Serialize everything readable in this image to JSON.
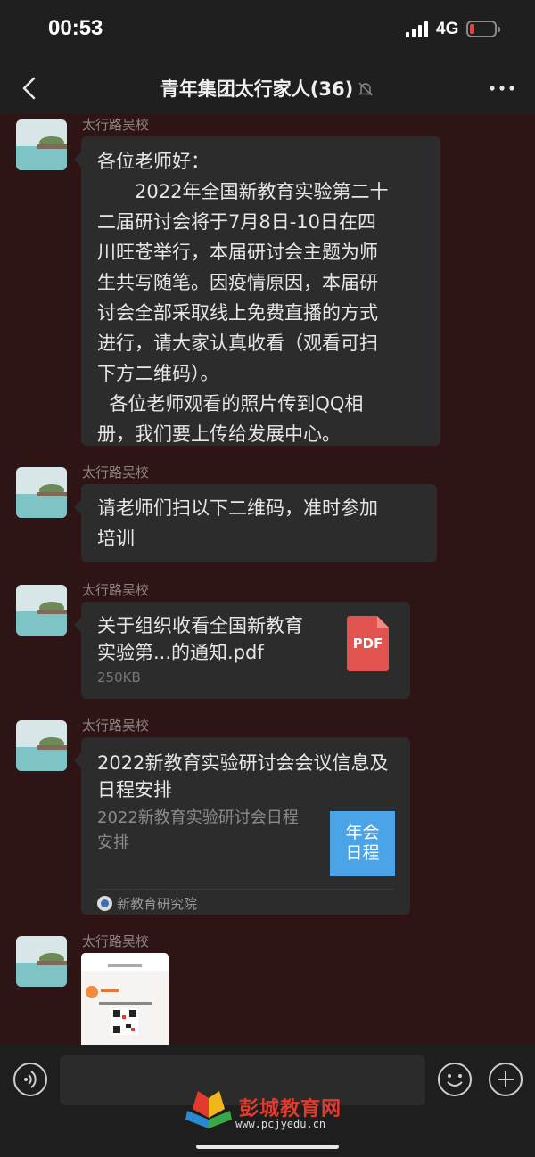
{
  "status_bar": {
    "time": "00:53",
    "network": "4G"
  },
  "header": {
    "back_label": "<",
    "title": "青年集团太行家人(36)"
  },
  "messages": [
    {
      "sender": "太行路吴校",
      "type": "text",
      "text": "各位老师好：\n　　2022年全国新教育实验第二十\n二届研讨会将于7月8日-10日在四\n川旺苍举行，本届研讨会主题为师\n生共写随笔。因疫情原因，本届研\n讨会全部采取线上免费直播的方式\n进行，请大家认真收看（观看可扫\n下方二维码）。\n  各位老师观看的照片传到QQ相\n册，我们要上传给发展中心。"
    },
    {
      "sender": "太行路吴校",
      "type": "text",
      "text": "请老师们扫以下二维码，准时参加\n培训"
    },
    {
      "sender": "太行路吴校",
      "type": "file",
      "file_name": "关于组织收看全国新教育实验第...的通知.pdf",
      "file_size": "250KB",
      "file_icon_label": "PDF"
    },
    {
      "sender": "太行路吴校",
      "type": "link",
      "title": "2022新教育实验研讨会会议信息及日程安排",
      "description": "2022新教育实验研讨会日程安排",
      "thumb_label": "年会\n日程",
      "source": "新教育研究院"
    },
    {
      "sender": "太行路吴校",
      "type": "image"
    }
  ],
  "input_bar": {
    "watermark_name": "彭城教育网",
    "watermark_url": "www.pcjyedu.cn"
  },
  "colors": {
    "chat_background": "#2e1414",
    "bubble": "#2c2c2c",
    "pdf_red": "#e0534f",
    "link_thumb": "#4ba3e8"
  }
}
